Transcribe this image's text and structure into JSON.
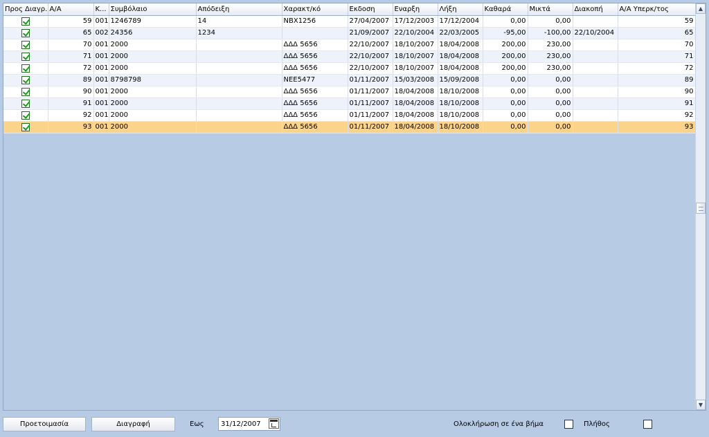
{
  "columns": [
    {
      "key": "del",
      "label": "Προς Διαγρ.",
      "width": 64
    },
    {
      "key": "aa",
      "label": "Α/Α",
      "width": 66
    },
    {
      "key": "k",
      "label": "Κ...",
      "width": 22
    },
    {
      "key": "contract",
      "label": "Συμβόλαιο",
      "width": 126
    },
    {
      "key": "receipt",
      "label": "Απόδειξη",
      "width": 124
    },
    {
      "key": "charact",
      "label": "Χαρακτ/κό",
      "width": 95
    },
    {
      "key": "issue",
      "label": "Εκδοση",
      "width": 65
    },
    {
      "key": "start",
      "label": "Εναρξη",
      "width": 65
    },
    {
      "key": "end",
      "label": "Λήξη",
      "width": 65
    },
    {
      "key": "net",
      "label": "Καθαρά",
      "width": 65
    },
    {
      "key": "gross",
      "label": "Μικτά",
      "width": 65
    },
    {
      "key": "stop",
      "label": "Διακοπή",
      "width": 65
    },
    {
      "key": "aa_agent",
      "label": "Α/Α Υπερκ/τος",
      "width": 112
    }
  ],
  "rows": [
    {
      "del": true,
      "aa": "59",
      "k": "001",
      "contract": "1246789",
      "receipt": "14",
      "charact": "NBX1256",
      "issue": "27/04/2007",
      "start": "17/12/2003",
      "end": "17/12/2004",
      "net": "0,00",
      "gross": "0,00",
      "stop": "",
      "aa_agent": "59"
    },
    {
      "del": true,
      "aa": "65",
      "k": "002",
      "contract": "24356",
      "receipt": "1234",
      "charact": "",
      "issue": "21/09/2007",
      "start": "22/10/2004",
      "end": "22/03/2005",
      "net": "-95,00",
      "gross": "-100,00",
      "stop": "22/10/2004",
      "aa_agent": "65"
    },
    {
      "del": true,
      "aa": "70",
      "k": "001",
      "contract": "2000",
      "receipt": "",
      "charact": "ΔΔΔ 5656",
      "issue": "22/10/2007",
      "start": "18/10/2007",
      "end": "18/04/2008",
      "net": "200,00",
      "gross": "230,00",
      "stop": "",
      "aa_agent": "70"
    },
    {
      "del": true,
      "aa": "71",
      "k": "001",
      "contract": "2000",
      "receipt": "",
      "charact": "ΔΔΔ 5656",
      "issue": "22/10/2007",
      "start": "18/10/2007",
      "end": "18/04/2008",
      "net": "200,00",
      "gross": "230,00",
      "stop": "",
      "aa_agent": "71"
    },
    {
      "del": true,
      "aa": "72",
      "k": "001",
      "contract": "2000",
      "receipt": "",
      "charact": "ΔΔΔ 5656",
      "issue": "22/10/2007",
      "start": "18/10/2007",
      "end": "18/04/2008",
      "net": "200,00",
      "gross": "230,00",
      "stop": "",
      "aa_agent": "72"
    },
    {
      "del": true,
      "aa": "89",
      "k": "001",
      "contract": "8798798",
      "receipt": "",
      "charact": "ΝΕΕ5477",
      "issue": "01/11/2007",
      "start": "15/03/2008",
      "end": "15/09/2008",
      "net": "0,00",
      "gross": "0,00",
      "stop": "",
      "aa_agent": "89"
    },
    {
      "del": true,
      "aa": "90",
      "k": "001",
      "contract": "2000",
      "receipt": "",
      "charact": "ΔΔΔ 5656",
      "issue": "01/11/2007",
      "start": "18/04/2008",
      "end": "18/10/2008",
      "net": "0,00",
      "gross": "0,00",
      "stop": "",
      "aa_agent": "90"
    },
    {
      "del": true,
      "aa": "91",
      "k": "001",
      "contract": "2000",
      "receipt": "",
      "charact": "ΔΔΔ 5656",
      "issue": "01/11/2007",
      "start": "18/04/2008",
      "end": "18/10/2008",
      "net": "0,00",
      "gross": "0,00",
      "stop": "",
      "aa_agent": "91"
    },
    {
      "del": true,
      "aa": "92",
      "k": "001",
      "contract": "2000",
      "receipt": "",
      "charact": "ΔΔΔ 5656",
      "issue": "01/11/2007",
      "start": "18/04/2008",
      "end": "18/10/2008",
      "net": "0,00",
      "gross": "0,00",
      "stop": "",
      "aa_agent": "92"
    },
    {
      "del": true,
      "aa": "93",
      "k": "001",
      "contract": "2000",
      "receipt": "",
      "charact": "ΔΔΔ 5656",
      "issue": "01/11/2007",
      "start": "18/04/2008",
      "end": "18/10/2008",
      "net": "0,00",
      "gross": "0,00",
      "stop": "",
      "aa_agent": "93",
      "selected": true
    }
  ],
  "numeric_columns": [
    "aa",
    "net",
    "gross",
    "aa_agent"
  ],
  "footer": {
    "prepare_label": "Προετοιμασία",
    "delete_label": "Διαγραφή",
    "until_label": "Εως",
    "until_date": "31/12/2007",
    "one_step_label": "Ολοκλήρωση σε ένα βήμα",
    "one_step_checked": false,
    "count_label": "Πλήθος",
    "count_checked": false
  },
  "colors": {
    "background": "#b8cbe4",
    "selected_row": "#fbd38a",
    "alt_row": "#eef3fb"
  }
}
